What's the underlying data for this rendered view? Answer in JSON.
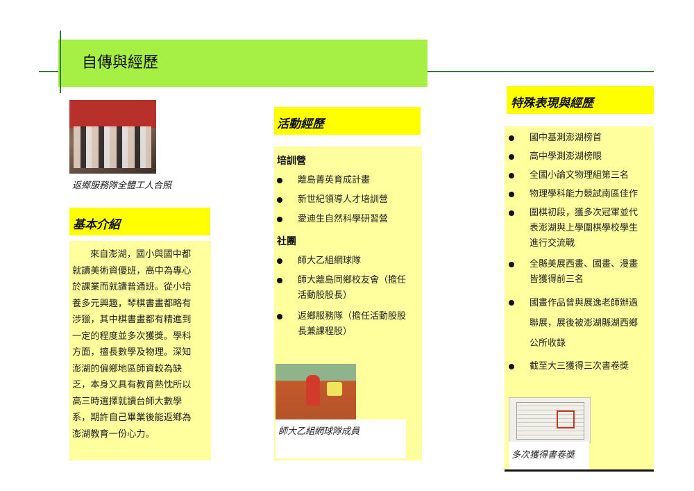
{
  "title": "自傳與經歷",
  "left_column": {
    "photo_caption": "返鄉服務隊全體工人合照",
    "intro_heading": "基本介紹",
    "intro_lines": [
      "來自澎湖，國小與國中都",
      "就讀美術資優班，高中為專心",
      "於課業而就讀普通班。從小培",
      "養多元興趣，琴棋書畫都略有",
      "涉獵，其中棋書畫都有精進到",
      "一定的程度並多次獲獎。學科",
      "方面，擅長數學及物理。深知",
      "澎湖的偏鄉地區師資較為缺",
      "乏，本身又具有教育熱忱所以",
      "高三時選擇就讀台師大數學",
      "系，期許自己畢業後能返鄉為",
      "澎湖教育一份心力。"
    ]
  },
  "middle_column": {
    "heading": "活動經歷",
    "training_label": "培訓營",
    "training_items": [
      "離島菁英育成計畫",
      "新世紀領導人才培訓營",
      "愛迪生自然科學研習營"
    ],
    "clubs_label": "社團",
    "club_items": [
      {
        "line1": "師大乙組網球隊",
        "line2": ""
      },
      {
        "line1": "師大離島同鄉校友會（擔任",
        "line2": "活動股股長）"
      },
      {
        "line1": "返鄉服務隊（擔任活動股股",
        "line2": "長兼課程股）"
      }
    ],
    "photo_caption": "師大乙組網球隊成員"
  },
  "right_column": {
    "heading": "特殊表現與經歷",
    "items": [
      {
        "lines": [
          "國中基測澎湖榜首"
        ]
      },
      {
        "lines": [
          "高中學測澎湖榜眼"
        ]
      },
      {
        "lines": [
          "全國小論文物理組第三名"
        ]
      },
      {
        "lines": [
          "物理學科能力競試南區佳作"
        ]
      },
      {
        "lines": [
          "圍棋初段，獲多次冠軍並代",
          "表澎湖與上學圍棋學校學生",
          "進行交流戰"
        ]
      },
      {
        "lines": [
          "全縣美展西畫、國畫、漫畫",
          "皆獲得前三名"
        ]
      },
      {
        "lines": [
          "國畫作品曾與展逸老師辦過",
          "聯展，展後被澎湖縣湖西鄉",
          "公所收錄"
        ]
      },
      {
        "lines": [
          "截至大三獲得三次書卷獎"
        ]
      }
    ],
    "photo_caption": "多次獲得書卷獎"
  },
  "colors": {
    "title_band": "#a6f046",
    "heading_band": "#ffff00",
    "panel": "#ffff9e",
    "rule": "#2e7d32"
  }
}
